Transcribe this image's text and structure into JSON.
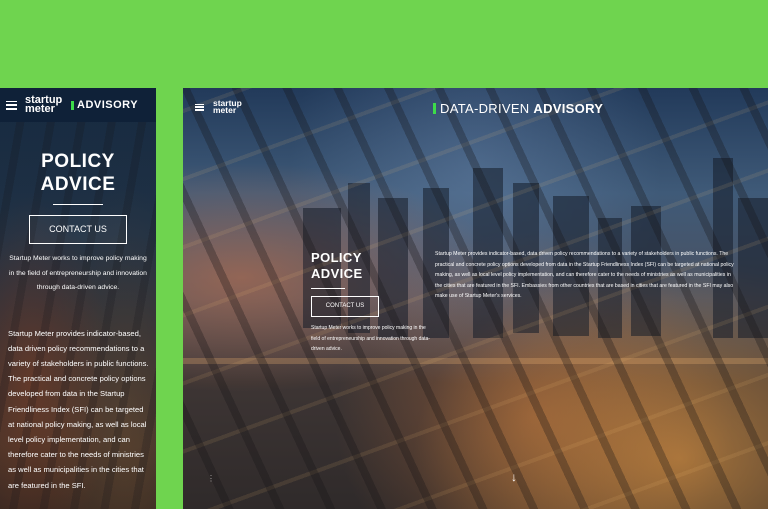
{
  "mobile": {
    "logo": [
      "startup",
      "meter"
    ],
    "brand": "ADVISORY",
    "title_line1": "POLICY",
    "title_line2": "ADVICE",
    "button": "CONTACT US",
    "lead": "Startup Meter works to improve policy making in the field of entrepreneurship and innovation through data-driven advice.",
    "body": "Startup Meter provides indicator-based, data driven policy recommendations to a variety of stakeholders in public functions. The practical and concrete policy options developed from data in the Startup Friendliness Index (SFI) can be targeted at national policy making, as well as local level policy implementation, and can therefore cater to the needs of ministries as well as municipalities in the cities that are featured in the SFI."
  },
  "desktop": {
    "logo": [
      "startup",
      "meter"
    ],
    "header_prefix": "DATA-DRIVEN",
    "header_bold": "ADVISORY",
    "title_line1": "POLICY",
    "title_line2": "ADVICE",
    "button": "CONTACT US",
    "lead": "Startup Meter works to improve policy making in the field of entrepreneurship and innovation through data-driven advice.",
    "body": "Startup Meter provides indicator-based, data driven policy recommendations to a variety of stakeholders in public functions. The practical and concrete policy options developed from data in the Startup Friendliness Index (SFI) can be targeted at national policy making, as well as local level policy implementation, and can therefore cater to the needs of ministries as well as municipalities in the cities that are featured in the SFI. Embassies from other countries that are based in cities that are featured in the SFI may also make use of Startup Meter's services.",
    "scroll_arrow": "↓",
    "side_dots": "⋮"
  },
  "colors": {
    "page_background": "#6fd44f",
    "accent": "#3ddc4a",
    "mobile_nav": "#0f2138"
  },
  "icons": {
    "menu": "menu-icon",
    "scroll": "arrow-down-icon"
  }
}
